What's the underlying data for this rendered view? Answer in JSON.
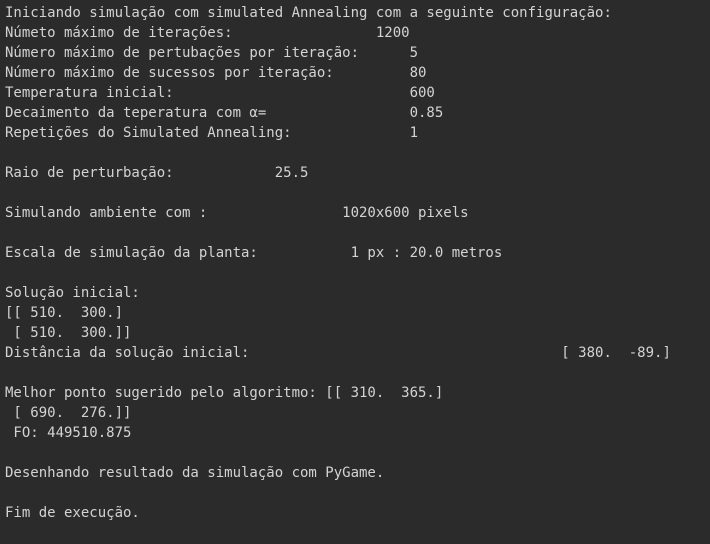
{
  "terminal": {
    "background": "#2b2b2b",
    "foreground": "#d3d3d3",
    "lines": [
      "Iniciando simulação com simulated Annealing com a seguinte configuração:",
      "Númeto máximo de iterações:                 1200",
      "Número máximo de pertubações por iteração:      5",
      "Número máximo de sucessos por iteração:         80",
      "Temperatura inicial:                            600",
      "Decaimento da teperatura com α=                 0.85",
      "Repetições do Simulated Annealing:              1",
      "",
      "Raio de perturbação:            25.5",
      "",
      "Simulando ambiente com :                1020x600 pixels",
      "",
      "Escala de simulação da planta:           1 px : 20.0 metros",
      "",
      "Solução inicial:",
      "[[ 510.  300.]",
      " [ 510.  300.]]",
      "Distância da solução inicial:                                     [ 380.  -89.]",
      "",
      "Melhor ponto sugerido pelo algoritmo: [[ 310.  365.]",
      " [ 690.  276.]]",
      " FO: 449510.875",
      "",
      "Desenhando resultado da simulação com PyGame.",
      "",
      "Fim de execução."
    ]
  }
}
